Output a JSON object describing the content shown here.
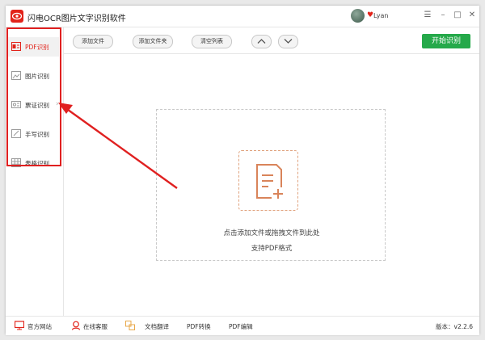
{
  "app": {
    "title": "闪电OCR图片文字识别软件",
    "username": "Lyan",
    "heart_icon": "heart-icon"
  },
  "toolbar": {
    "add_file": "添加文件",
    "add_folder": "添加文件夹",
    "clear_list": "清空列表",
    "start": "开始识别"
  },
  "sidebar": {
    "items": [
      {
        "label": "PDF识别",
        "icon": "pdf-icon",
        "active": true
      },
      {
        "label": "图片识别",
        "icon": "image-icon",
        "active": false
      },
      {
        "label": "票证识别",
        "icon": "ticket-icon",
        "active": false
      },
      {
        "label": "手写识别",
        "icon": "handwriting-icon",
        "active": false
      },
      {
        "label": "表格识别",
        "icon": "table-icon",
        "active": false
      }
    ]
  },
  "dropzone": {
    "line1": "点击添加文件或拖拽文件到此处",
    "line2": "支持PDF格式"
  },
  "footer": {
    "official_site": "官方网站",
    "online_service": "在线客服",
    "doc_translate": "文档翻译",
    "pdf_convert": "PDF转换",
    "pdf_edit": "PDF编辑",
    "version": "版本：v2.2.6"
  },
  "colors": {
    "accent_red": "#e2231a",
    "start_green": "#25a94a",
    "annotation_red": "#e02020"
  }
}
